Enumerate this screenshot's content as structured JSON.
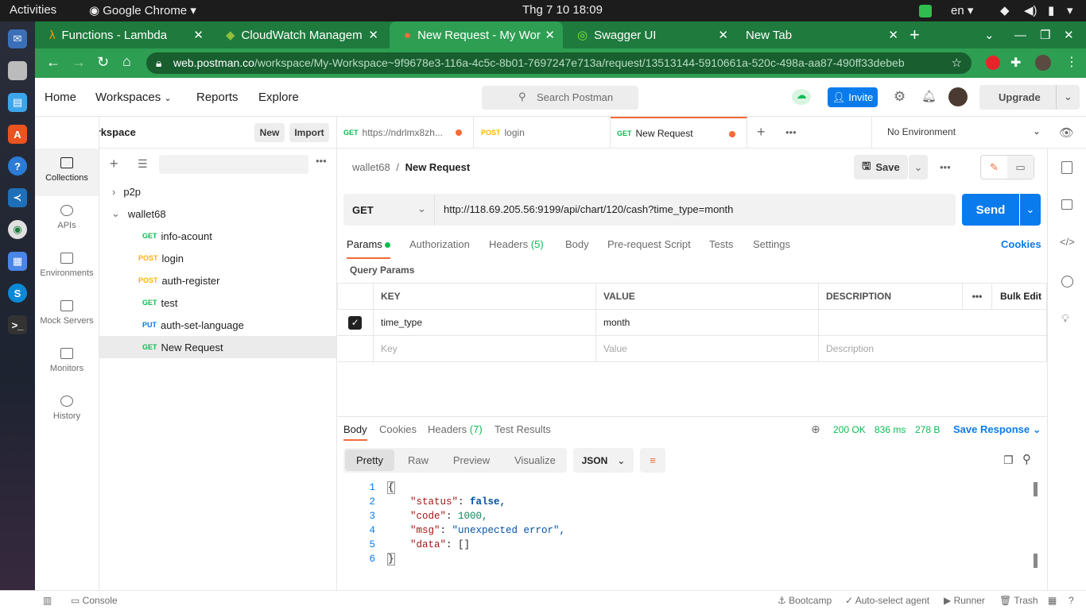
{
  "topbar": {
    "activities": "Activities",
    "app": "Google Chrome",
    "clock": "Thg 7 10  18:09",
    "lang": "en"
  },
  "browser": {
    "tabs": [
      {
        "label": "Functions - Lambda"
      },
      {
        "label": "CloudWatch Managem"
      },
      {
        "label": "New Request - My Wor"
      },
      {
        "label": "Swagger UI"
      },
      {
        "label": "New Tab"
      }
    ],
    "url_host": "web.postman.co",
    "url_path": "/workspace/My-Workspace~9f9678e3-116a-4c5c-8b01-7697247e713a/request/13513144-5910661a-520c-498a-aa87-490ff33debeb"
  },
  "header": {
    "home": "Home",
    "workspaces": "Workspaces",
    "reports": "Reports",
    "explore": "Explore",
    "search_placeholder": "Search Postman",
    "invite": "Invite",
    "upgrade": "Upgrade"
  },
  "workspace": {
    "name": "My Workspace",
    "new": "New",
    "import": "Import"
  },
  "rail": [
    {
      "label": "Collections"
    },
    {
      "label": "APIs"
    },
    {
      "label": "Environments"
    },
    {
      "label": "Mock Servers"
    },
    {
      "label": "Monitors"
    },
    {
      "label": "History"
    }
  ],
  "collections": {
    "p2p": "p2p",
    "wallet": "wallet68",
    "items": [
      {
        "method": "GET",
        "name": "info-acount"
      },
      {
        "method": "POST",
        "name": "login"
      },
      {
        "method": "POST",
        "name": "auth-register"
      },
      {
        "method": "GET",
        "name": "test"
      },
      {
        "method": "PUT",
        "name": "auth-set-language"
      },
      {
        "method": "GET",
        "name": "New Request"
      }
    ]
  },
  "reqtabs": [
    {
      "method": "GET",
      "name": "https://ndrlmx8zh..."
    },
    {
      "method": "POST",
      "name": "login"
    },
    {
      "method": "GET",
      "name": "New Request"
    }
  ],
  "environment": "No Environment",
  "request": {
    "breadcrumb_parent": "wallet68",
    "breadcrumb_sep": "/",
    "title": "New Request",
    "save": "Save",
    "method": "GET",
    "url": "http://118.69.205.56:9199/api/chart/120/cash?time_type=month",
    "send": "Send",
    "tabs": {
      "params": "Params",
      "auth": "Authorization",
      "headers": "Headers",
      "headers_count": "(5)",
      "body": "Body",
      "prereq": "Pre-request Script",
      "tests": "Tests",
      "settings": "Settings",
      "cookies": "Cookies"
    },
    "query_params": "Query Params",
    "cols": {
      "key": "KEY",
      "value": "VALUE",
      "desc": "DESCRIPTION",
      "bulk": "Bulk Edit"
    },
    "row": {
      "key": "time_type",
      "value": "month"
    },
    "placeholders": {
      "key": "Key",
      "value": "Value",
      "desc": "Description"
    }
  },
  "response": {
    "tabs": {
      "body": "Body",
      "cookies": "Cookies",
      "headers": "Headers",
      "headers_count": "(7)",
      "tests": "Test Results"
    },
    "status": "200 OK",
    "time": "836 ms",
    "size": "278 B",
    "save": "Save Response",
    "views": {
      "pretty": "Pretty",
      "raw": "Raw",
      "preview": "Preview",
      "visualize": "Visualize"
    },
    "format": "JSON",
    "lines": [
      {
        "n": "1",
        "t": "{"
      },
      {
        "n": "2",
        "k": "\"status\"",
        "v": "false,"
      },
      {
        "n": "3",
        "k": "\"code\"",
        "v": "1000,"
      },
      {
        "n": "4",
        "k": "\"msg\"",
        "v": "\"unexpected error\","
      },
      {
        "n": "5",
        "k": "\"data\"",
        "v": "[]"
      },
      {
        "n": "6",
        "t": "}"
      }
    ]
  },
  "statusbar": {
    "console": "Console",
    "bootcamp": "Bootcamp",
    "agent": "Auto-select agent",
    "runner": "Runner",
    "trash": "Trash"
  }
}
